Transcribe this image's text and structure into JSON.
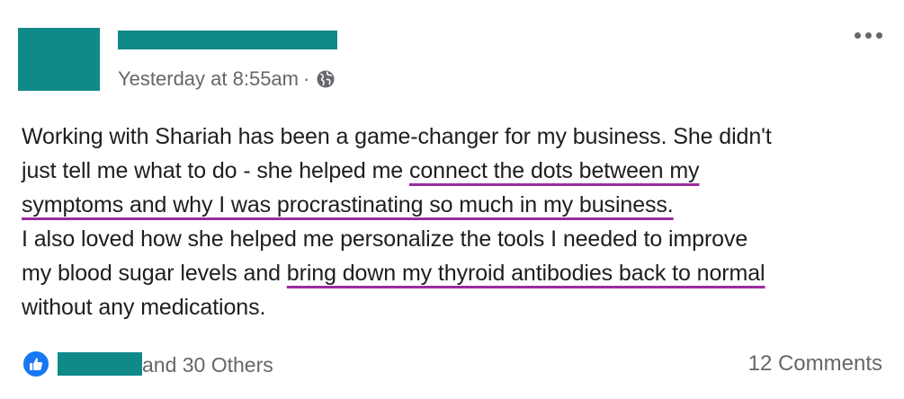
{
  "post": {
    "timestamp": "Yesterday at 8:55am",
    "separator": "·",
    "privacy_icon": "globe-icon",
    "more_icon": "more-options-icon",
    "lines": [
      [
        {
          "text": "Working with Shariah has been a game-changer for my business. She didn't",
          "highlight": false
        }
      ],
      [
        {
          "text": "just tell me what to do - she helped me ",
          "highlight": false
        },
        {
          "text": "connect the dots between my",
          "highlight": true
        }
      ],
      [
        {
          "text": "symptoms and why I was procrastinating so much in my business.",
          "highlight": true
        }
      ],
      [
        {
          "text": "I also loved how she helped me personalize the tools I needed to improve",
          "highlight": false
        }
      ],
      [
        {
          "text": "my blood sugar levels and ",
          "highlight": false
        },
        {
          "text": "bring down my thyroid antibodies back to normal",
          "highlight": true
        }
      ],
      [
        {
          "text": "without any medications.",
          "highlight": false
        }
      ]
    ]
  },
  "reactions": {
    "icon": "like-icon",
    "others_text": "and 30 Others",
    "comments_text": "12 Comments"
  },
  "colors": {
    "redaction": "#0f8a88",
    "highlight_underline": "#9b2c9d",
    "like_blue": "#1877f2",
    "meta_gray": "#65676b"
  }
}
